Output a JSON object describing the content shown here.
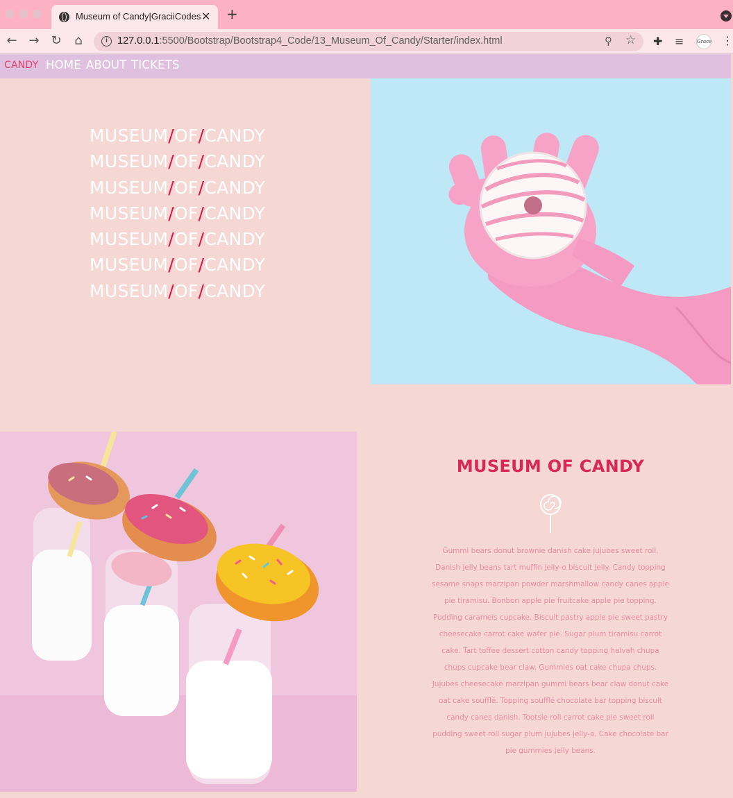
{
  "browser": {
    "tab_title": "Museum of Candy|GraciiCodes",
    "url_host": "127.0.0.1",
    "url_rest": ":5500/Bootstrap/Bootstrap4_Code/13_Museum_Of_Candy/Starter/index.html",
    "profile_label": "Grace"
  },
  "nav": {
    "brand": "CANDY",
    "links": [
      "HOME",
      "ABOUT",
      "TICKETS"
    ]
  },
  "hero": {
    "word1": "MUSEUM",
    "word2": "OF",
    "word3": "CANDY",
    "slash": "/"
  },
  "about": {
    "title": "MUSEUM OF CANDY",
    "text": "Gummi bears donut brownie danish cake jujubes sweet roll. Danish jelly beans tart muffin jelly-o biscuit jelly. Candy topping sesame snaps marzipan powder marshmallow candy canes apple pie tiramisu. Bonbon apple pie fruitcake apple pie topping. Pudding caramels cupcake. Biscuit pastry apple pie sweet pastry cheesecake carrot cake wafer pie. Sugar plum tiramisu carrot cake. Tart toffee dessert cotton candy topping halvah chupa chups cupcake bear claw. Gummies oat cake chupa chups. Jujubes cheesecake marzipan gummi bears bear claw donut cake oat cake soufflé. Topping soufflé chocolate bar topping biscuit candy canes danish. Tootsie roll carrot cake pie sweet roll pudding sweet roll sugar plum jujubes jelly-o. Cake chocolate bar pie gummies jelly beans."
  },
  "colors": {
    "page_bg": "#f5d8d4",
    "nav_bg": "#dfc0df",
    "brand": "#e0426f",
    "slash": "#e4113f",
    "title": "#d62a55",
    "body_text": "#e98aa3",
    "sky": "#bfe8f6",
    "glove": "#f59ac2"
  }
}
